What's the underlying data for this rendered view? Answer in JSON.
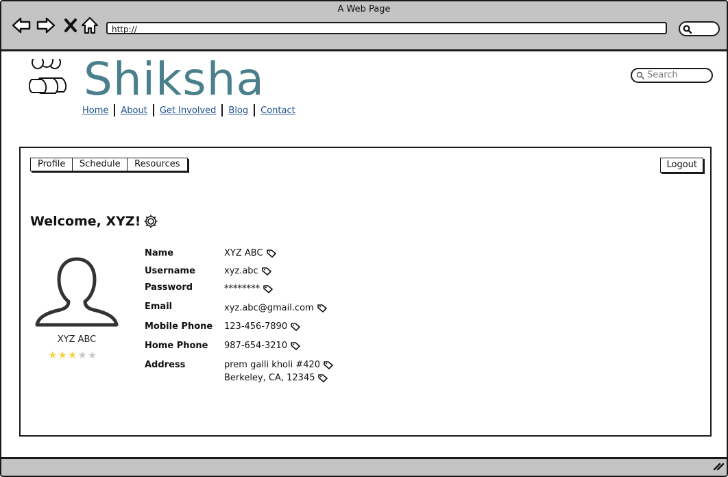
{
  "browser": {
    "window_title": "A Web Page",
    "url": "http://"
  },
  "site": {
    "title": "Shiksha",
    "search_placeholder": "Search",
    "accent_color": "#4a7f8c",
    "nav": [
      "Home",
      "About",
      "Get Involved",
      "Blog",
      "Contact"
    ]
  },
  "tabs": [
    "Profile",
    "Schedule",
    "Resources"
  ],
  "logout_label": "Logout",
  "welcome": "Welcome, XYZ!",
  "profile": {
    "name": "XYZ ABC",
    "rating": 3,
    "rating_max": 5,
    "fields": [
      {
        "label": "Name",
        "value": "XYZ ABC"
      },
      {
        "label": "Username",
        "value": "xyz.abc"
      },
      {
        "label": "Password",
        "value": "********"
      },
      {
        "label": "Email",
        "value": "xyz.abc@gmail.com"
      },
      {
        "label": "Mobile Phone",
        "value": "123-456-7890"
      },
      {
        "label": "Home Phone",
        "value": "987-654-3210"
      },
      {
        "label": "Address",
        "value": "prem galli kholi #420"
      }
    ],
    "address_line2": "Berkeley, CA, 12345"
  }
}
